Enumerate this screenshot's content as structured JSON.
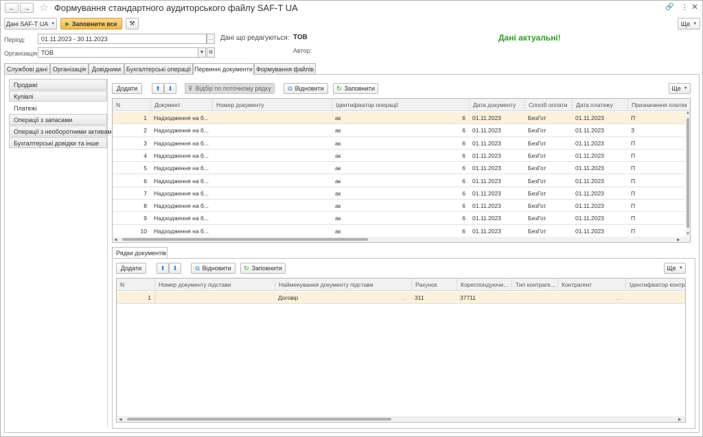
{
  "window": {
    "title": "Формування стандартного аудиторського файлу SAF-T UA"
  },
  "toolbar": {
    "data_btn": "Дані SAF-T UA",
    "fill_all": "Заповнити все",
    "more": "Ще"
  },
  "header": {
    "period_label": "Період:",
    "period_value": "01.11.2023 - 30.11.2023",
    "editing_label": "Дані що редагуються:",
    "editing_value": "ТОВ",
    "author_label": "Автор:",
    "status": "Дані актуальні!",
    "org_label": "Організація:",
    "org_value": "ТОВ"
  },
  "tabs": [
    "Службові дані",
    "Організація",
    "Довідники",
    "Бухгалтерські операції",
    "Первинні документи",
    "Формування файлів"
  ],
  "side_nav": [
    "Продажі",
    "Купівлі",
    "Платежі",
    "Операції з запасами",
    "Операції з необоротними активами",
    "Бухгалтерські довідки та інше"
  ],
  "top_toolbar": {
    "add": "Додати",
    "filter": "Відбір по поточному рядку",
    "restore": "Відновити",
    "fill": "Заповнити",
    "more": "Ще"
  },
  "top_table": {
    "columns": [
      "N",
      "Документ",
      "Номер документу",
      "Ідентифікатор операції",
      "Дата документу",
      "Спосіб оплати",
      "Дата платежу",
      "Призначення платежу"
    ],
    "rows": [
      {
        "n": "1",
        "doc": "Надходження на б...",
        "num": "",
        "id": "ак",
        "id2": "6",
        "date": "01.11.2023",
        "pay": "БезГот",
        "pdate": "01.11.2023",
        "purpose": "П"
      },
      {
        "n": "2",
        "doc": "Надходження на б...",
        "num": "",
        "id": "ак",
        "id2": "6",
        "date": "01.11.2023",
        "pay": "БезГот",
        "pdate": "01.11.2023",
        "purpose": "З"
      },
      {
        "n": "3",
        "doc": "Надходження на б...",
        "num": "",
        "id": "ак",
        "id2": "6",
        "date": "01.11.2023",
        "pay": "БезГот",
        "pdate": "01.11.2023",
        "purpose": "П"
      },
      {
        "n": "4",
        "doc": "Надходження на б...",
        "num": "",
        "id": "ак",
        "id2": "6",
        "date": "01.11.2023",
        "pay": "БезГот",
        "pdate": "01.11.2023",
        "purpose": "П"
      },
      {
        "n": "5",
        "doc": "Надходження на б...",
        "num": "",
        "id": "ак",
        "id2": "6",
        "date": "01.11.2023",
        "pay": "БезГот",
        "pdate": "01.11.2023",
        "purpose": "П"
      },
      {
        "n": "6",
        "doc": "Надходження на б...",
        "num": "",
        "id": "ак",
        "id2": "6",
        "date": "01.11.2023",
        "pay": "БезГот",
        "pdate": "01.11.2023",
        "purpose": "П"
      },
      {
        "n": "7",
        "doc": "Надходження на б...",
        "num": "",
        "id": "ак",
        "id2": "6",
        "date": "01.11.2023",
        "pay": "БезГот",
        "pdate": "01.11.2023",
        "purpose": "П"
      },
      {
        "n": "8",
        "doc": "Надходження на б...",
        "num": "",
        "id": "ак",
        "id2": "6",
        "date": "01.11.2023",
        "pay": "БезГот",
        "pdate": "01.11.2023",
        "purpose": "П"
      },
      {
        "n": "9",
        "doc": "Надходження на б...",
        "num": "",
        "id": "ак",
        "id2": "6",
        "date": "01.11.2023",
        "pay": "БезГот",
        "pdate": "01.11.2023",
        "purpose": "П"
      },
      {
        "n": "10",
        "doc": "Надходження на б...",
        "num": "",
        "id": "ак",
        "id2": "6",
        "date": "01.11.2023",
        "pay": "БезГот",
        "pdate": "01.11.2023",
        "purpose": "П"
      }
    ]
  },
  "lines_tab": "Рядки документів",
  "bottom_toolbar": {
    "add": "Додати",
    "restore": "Відновити",
    "fill": "Заповнити",
    "more": "Ще"
  },
  "bottom_table": {
    "columns": [
      "N",
      "Номер документу підстави",
      "Найменування документу підстави",
      "Рахунок",
      "Кореспондуючи...",
      "Тип контраге...",
      "Контрагент",
      "Ідентифікатор контрагента"
    ],
    "rows": [
      {
        "n": "1",
        "num": "",
        "name": "Договір",
        "acc": "311",
        "corr": "37711",
        "type": "",
        "contr": "",
        "cid": ""
      }
    ]
  },
  "colors": {
    "accent": "#f6c35b",
    "status": "#2d9d23",
    "selected_row": "#fbf1dc",
    "arrow_blue": "#3b7fd0"
  }
}
